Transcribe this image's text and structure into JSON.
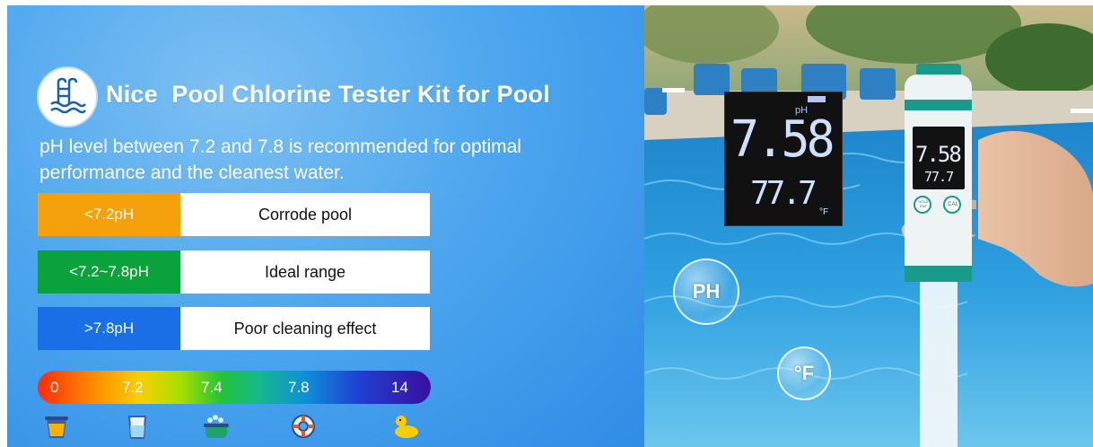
{
  "header": {
    "title": "Nice  Pool Chlorine Tester Kit for Pool",
    "logo_icon": "pool-ladder-icon"
  },
  "description": "pH level between 7.2 and 7.8 is recommended for optimal performance and the cleanest water.",
  "ranges": [
    {
      "tag": "<7.2pH",
      "label": "Corrode pool",
      "color": "#f5a10b"
    },
    {
      "tag": "<7.2~7.8pH",
      "label": "Ideal range",
      "color": "#0aa23a"
    },
    {
      "tag": ">7.8pH",
      "label": "Poor cleaning effect",
      "color": "#1a6fe6"
    }
  ],
  "scale": {
    "ticks": [
      "0",
      "7.2",
      "7.4",
      "7.8",
      "14"
    ],
    "icons": [
      "cup-icon",
      "water-glass-icon",
      "bathtub-icon",
      "life-ring-icon",
      "rubber-duck-icon"
    ]
  },
  "photo": {
    "display": {
      "ph_label": "pH",
      "ph_value": "7.58",
      "temp_value": "77.7",
      "temp_unit": "°F"
    },
    "bubble_ph": "PH",
    "bubble_temp": "°F",
    "pen_ph_value": "7.58",
    "pen_temp_value": "77.7",
    "pen_button_left": "HOLD ENT",
    "pen_button_right": "CAL"
  }
}
